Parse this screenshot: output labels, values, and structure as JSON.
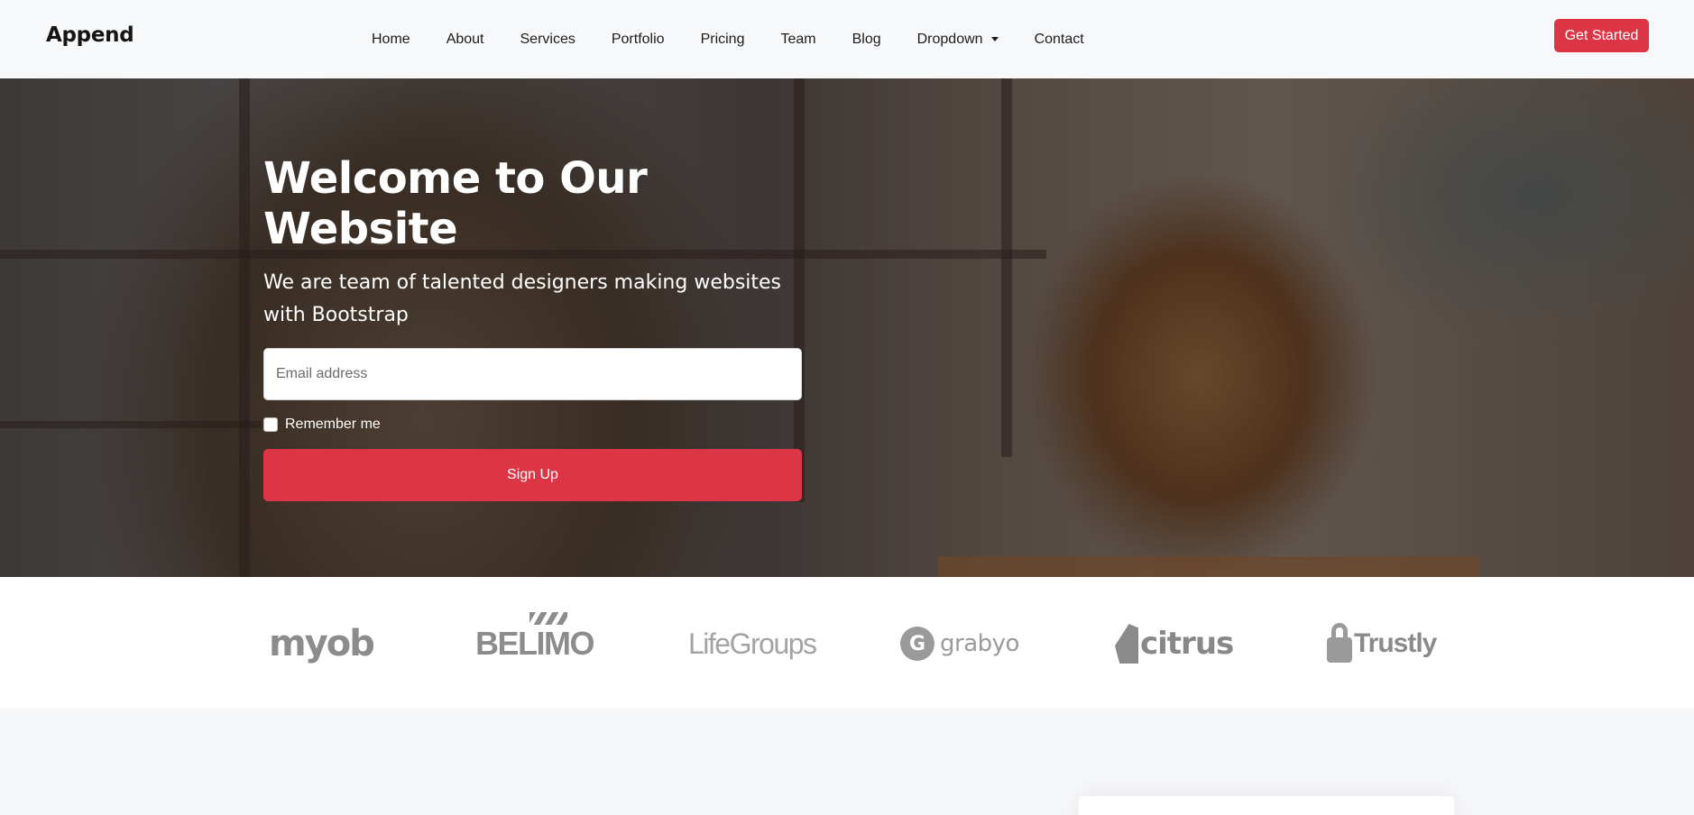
{
  "header": {
    "logo": "Append",
    "nav": [
      {
        "label": "Home"
      },
      {
        "label": "About"
      },
      {
        "label": "Services"
      },
      {
        "label": "Portfolio"
      },
      {
        "label": "Pricing"
      },
      {
        "label": "Team"
      },
      {
        "label": "Blog"
      },
      {
        "label": "Dropdown",
        "has_caret": true
      },
      {
        "label": "Contact"
      }
    ],
    "cta_label": "Get Started"
  },
  "hero": {
    "title": "Welcome to Our Website",
    "subtitle": "We are team of talented designers making websites with Bootstrap",
    "email_placeholder": "Email address",
    "email_value": "",
    "remember_label": "Remember me",
    "remember_checked": false,
    "signup_label": "Sign Up"
  },
  "clients": [
    {
      "name": "myob"
    },
    {
      "name": "BELIMO"
    },
    {
      "name": "LifeGroups"
    },
    {
      "name": "grabyo"
    },
    {
      "name": "citrus"
    },
    {
      "name": "Trustly"
    }
  ],
  "colors": {
    "accent": "#dc3545",
    "header_bg": "#f7f8fa",
    "logo_gray": "#8c8c8c"
  }
}
